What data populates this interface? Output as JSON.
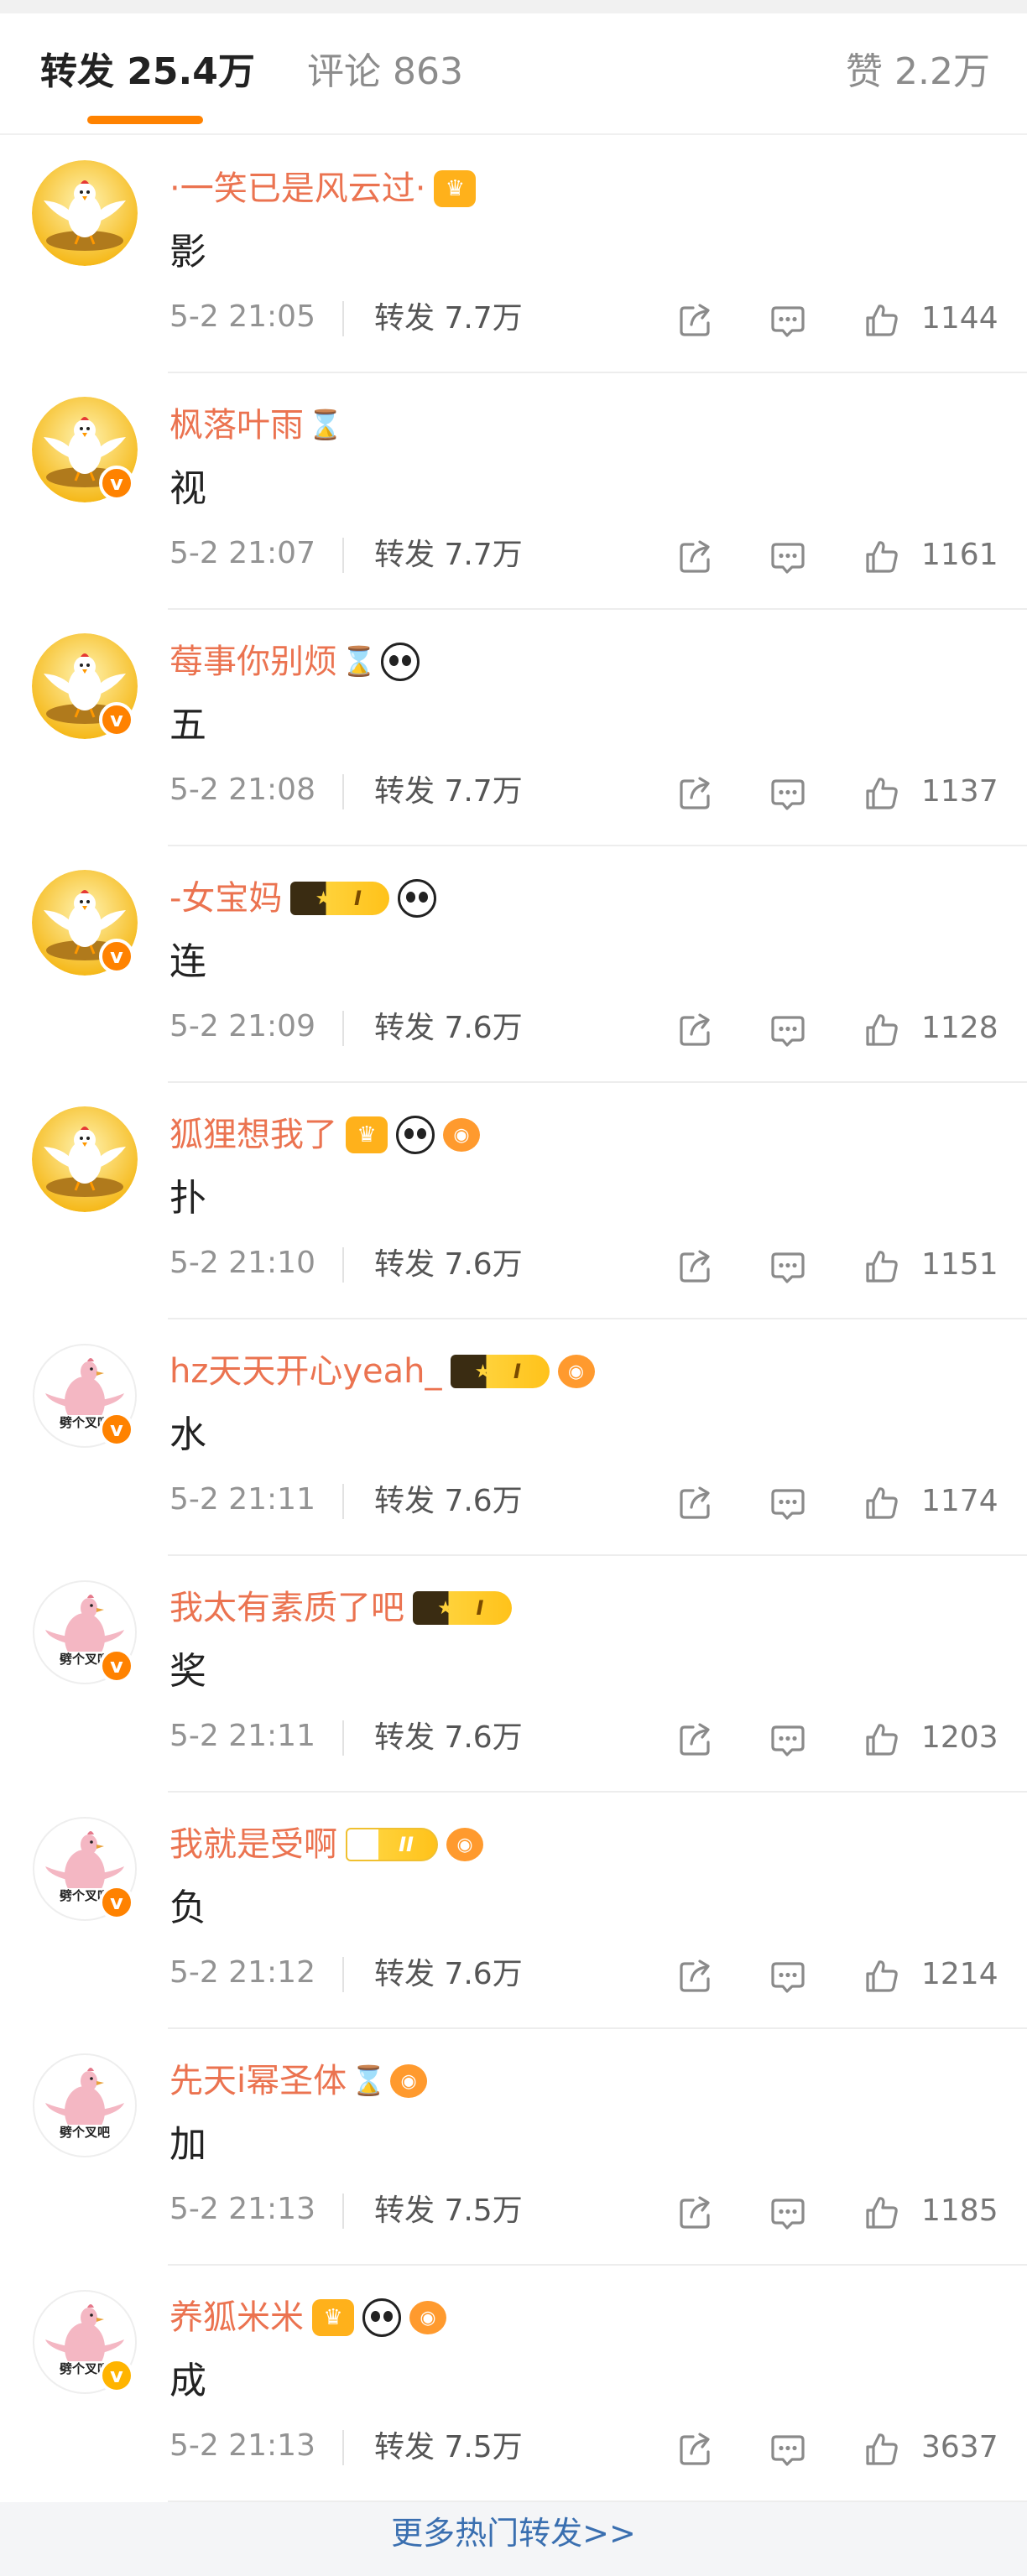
{
  "tabs": {
    "repost": "转发 25.4万",
    "comment": "评论 863",
    "likes": "赞 2.2万"
  },
  "repost_label": "转发",
  "items": [
    {
      "name": "·一笑已是风云过·",
      "badges": [
        "crown"
      ],
      "content": "影",
      "time": "5-2 21:05",
      "reposts": "7.7万",
      "likes": "1144",
      "avatar": "chicken",
      "verified": false
    },
    {
      "name": "枫落叶雨",
      "badges": [
        "hourglass"
      ],
      "content": "视",
      "time": "5-2 21:07",
      "reposts": "7.7万",
      "likes": "1161",
      "avatar": "chicken",
      "verified": true
    },
    {
      "name": "莓事你别烦",
      "badges": [
        "hourglass",
        "panda"
      ],
      "content": "五",
      "time": "5-2 21:08",
      "reposts": "7.7万",
      "likes": "1137",
      "avatar": "chicken",
      "verified": true
    },
    {
      "name": "-女宝妈",
      "badges": [
        "vip",
        "panda"
      ],
      "content": "连",
      "time": "5-2 21:09",
      "reposts": "7.6万",
      "likes": "1128",
      "avatar": "chicken",
      "verified": true
    },
    {
      "name": "狐狸想我了",
      "badges": [
        "crown",
        "panda",
        "fish"
      ],
      "content": "扑",
      "time": "5-2 21:10",
      "reposts": "7.6万",
      "likes": "1151",
      "avatar": "chicken",
      "verified": false
    },
    {
      "name": "hz天天开心yeah_",
      "badges": [
        "vip",
        "fish"
      ],
      "content": "水",
      "time": "5-2 21:11",
      "reposts": "7.6万",
      "likes": "1174",
      "avatar": "pink",
      "verified": true
    },
    {
      "name": "我太有素质了吧",
      "badges": [
        "vip"
      ],
      "content": "奖",
      "time": "5-2 21:11",
      "reposts": "7.6万",
      "likes": "1203",
      "avatar": "pink",
      "verified": true
    },
    {
      "name": "我就是受啊",
      "badges": [
        "bunny",
        "fish"
      ],
      "content": "负",
      "time": "5-2 21:12",
      "reposts": "7.6万",
      "likes": "1214",
      "avatar": "pink",
      "verified": true
    },
    {
      "name": "先天i幂圣体",
      "badges": [
        "hourglass",
        "fish"
      ],
      "content": "加",
      "time": "5-2 21:13",
      "reposts": "7.5万",
      "likes": "1185",
      "avatar": "pink",
      "verified": false
    },
    {
      "name": "养狐米米",
      "badges": [
        "crown",
        "panda",
        "fish"
      ],
      "content": "成",
      "time": "5-2 21:13",
      "reposts": "7.5万",
      "likes": "3637",
      "avatar": "pink",
      "verified": true
    }
  ],
  "badge_text": {
    "vip": "I",
    "bunny": "II"
  },
  "more": "更多热门转发>>",
  "colors": {
    "accent": "#ff8200",
    "username": "#eb7350",
    "link": "#3a6fb0"
  },
  "icons": [
    "share-icon",
    "comment-icon",
    "like-icon",
    "verified-icon",
    "hourglass-icon",
    "panda-icon",
    "fish-icon",
    "crown-icon"
  ]
}
